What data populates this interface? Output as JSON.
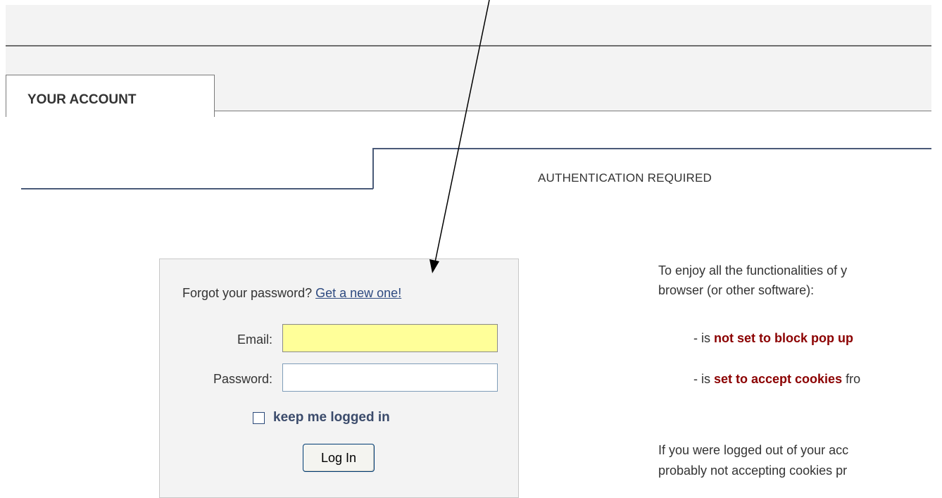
{
  "tab": {
    "label": "YOUR ACCOUNT"
  },
  "section": {
    "title": "AUTHENTICATION REQUIRED"
  },
  "login": {
    "forgot_text": "Forgot your password?",
    "forgot_link": "Get a new one!",
    "email_label": "Email:",
    "email_value": "",
    "password_label": "Password:",
    "password_value": "",
    "remember_label": "keep me logged in",
    "remember_checked": false,
    "login_button": "Log In"
  },
  "info": {
    "line1": "To enjoy all the functionalities of y",
    "line2": "browser (or other software):",
    "line3_prefix": "- is ",
    "line3_strong": "not set to block pop up",
    "line4_prefix": "- is ",
    "line4_strong": "set to accept cookies",
    "line4_suffix": " fro",
    "line5": "If you were logged out of your acc",
    "line6": "probably not accepting cookies pr"
  },
  "colors": {
    "accent_link": "#2e4a80",
    "emphasis_red": "#8b0000",
    "email_field_bg": "#ffff99",
    "rule_blue": "#4a5a78"
  },
  "icons": [
    "arrow-annotation-icon",
    "checkbox-icon"
  ]
}
